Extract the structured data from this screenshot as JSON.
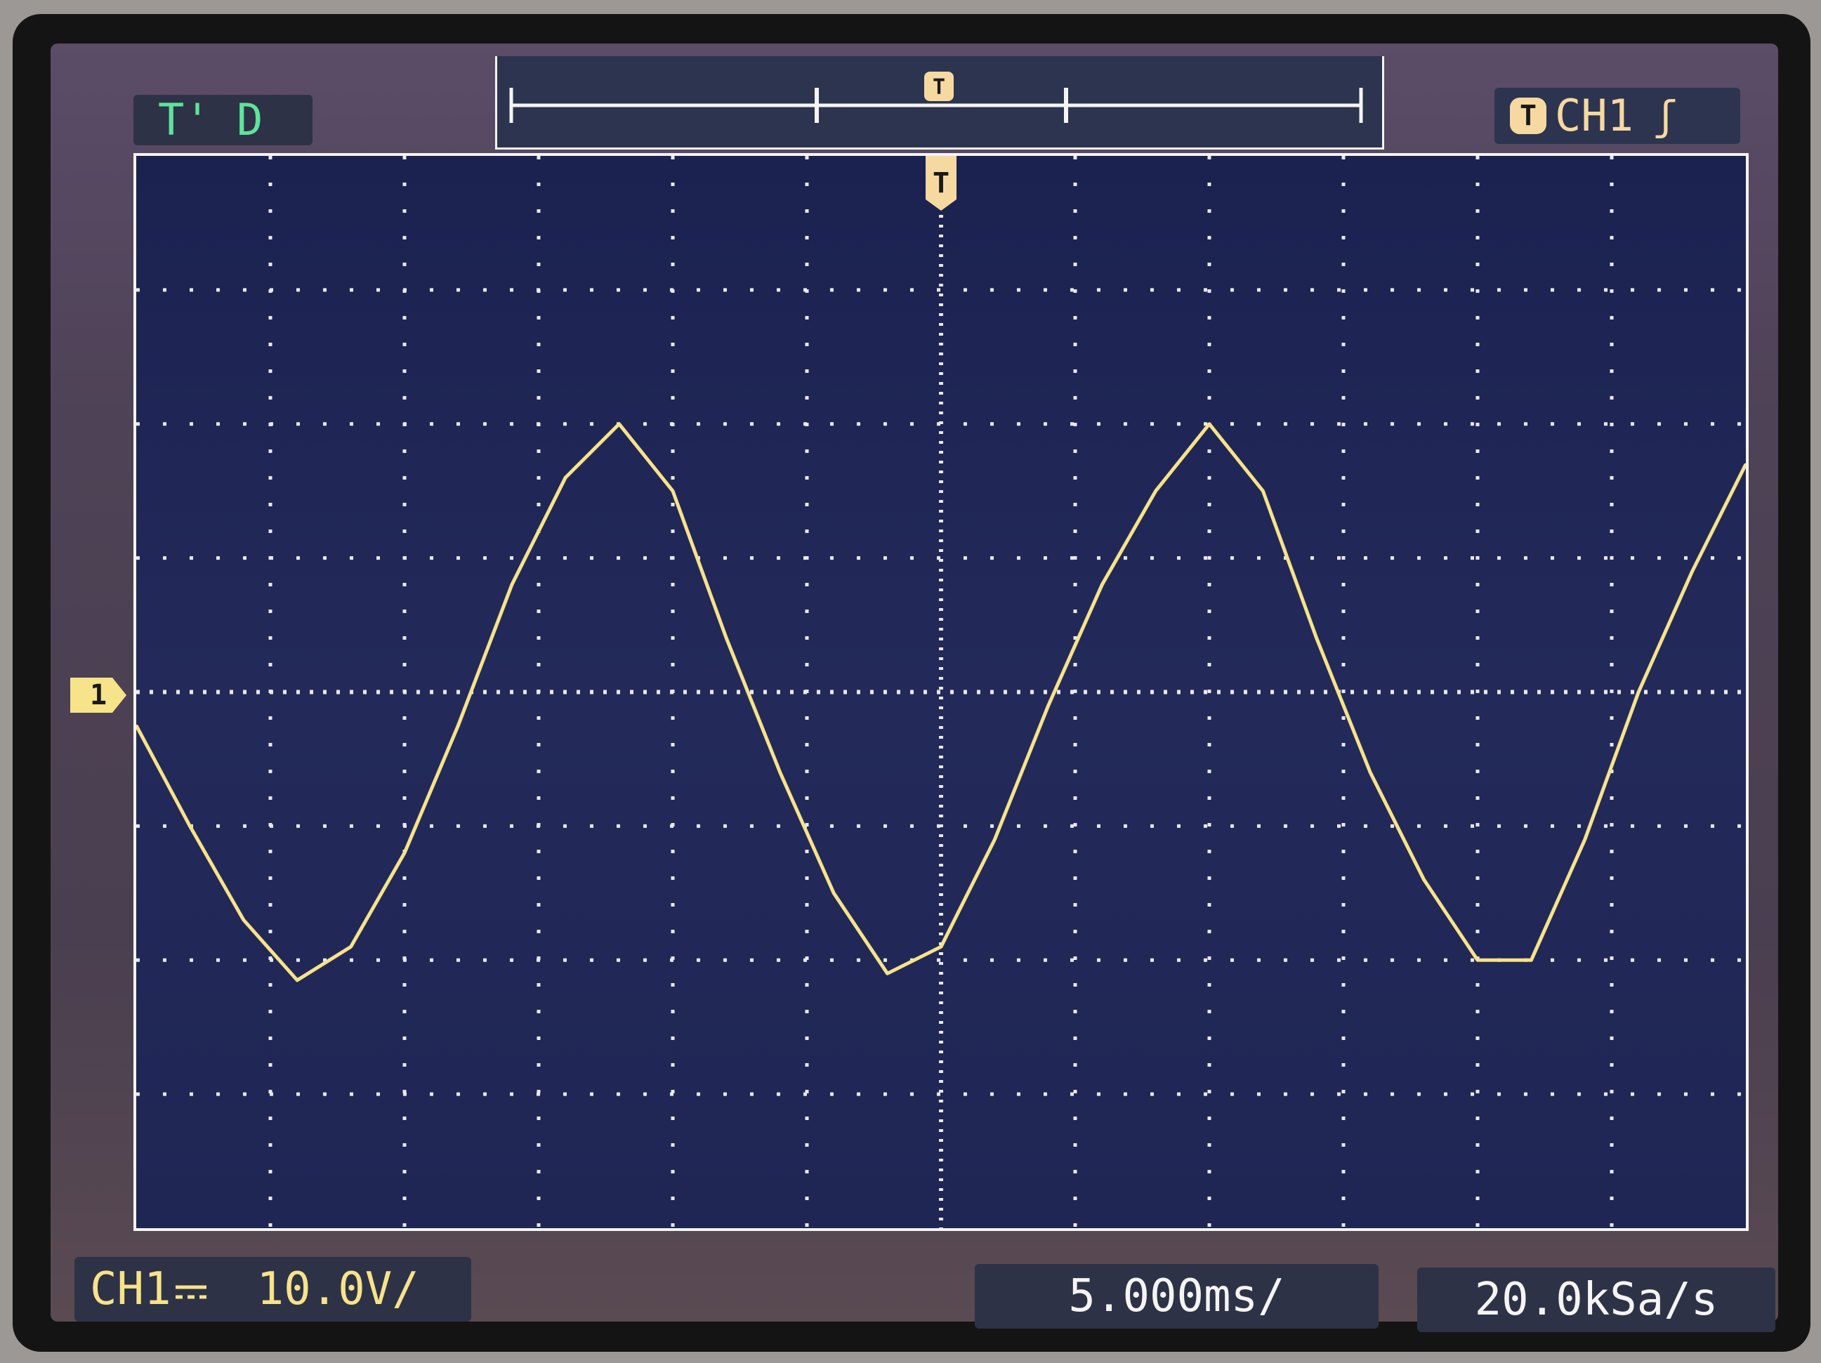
{
  "status": {
    "trigger_status": "T' D"
  },
  "trigger": {
    "source": "CH1",
    "icon": "T",
    "slope_icon": "rising-edge-icon",
    "marker_label": "T"
  },
  "channel": {
    "marker_label": "1",
    "label": "CH1",
    "coupling_icon": "dc-coupling-icon",
    "scale": "10.0V/"
  },
  "timebase": {
    "scale": "5.000ms/"
  },
  "sample_rate": {
    "value": "20.0kSa/s"
  },
  "colors": {
    "trace": "#f6e38a",
    "trigger": "#f6d9a0",
    "status": "#5fe39a",
    "grid_background": "#1f2654"
  },
  "chart_data": {
    "type": "line",
    "title": "",
    "xlabel": "",
    "ylabel": "",
    "grid": true,
    "x_divisions": 12,
    "y_divisions": 8,
    "xlim": [
      -30,
      30
    ],
    "ylim": [
      -40,
      40
    ],
    "series": [
      {
        "name": "CH1",
        "x": [
          -30,
          -28,
          -26,
          -24,
          -22,
          -20,
          -18,
          -16,
          -14,
          -12,
          -10,
          -8,
          -6,
          -4,
          -2,
          0,
          2,
          4,
          6,
          8,
          10,
          12,
          14,
          16,
          18,
          20,
          22,
          24,
          26,
          28,
          30
        ],
        "y": [
          -2.5,
          -10,
          -17,
          -21.5,
          -19,
          -12,
          -2.5,
          8,
          16,
          20,
          15,
          4,
          -6,
          -15,
          -21,
          -19,
          -11,
          -1,
          8,
          15,
          20,
          15,
          4,
          -6,
          -14,
          -20,
          -20,
          -11,
          0,
          9,
          17
        ]
      }
    ]
  }
}
